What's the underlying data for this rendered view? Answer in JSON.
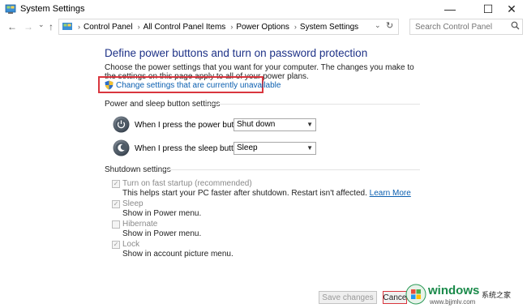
{
  "window": {
    "title": "System Settings",
    "minimize": "—",
    "maximize": "☐",
    "close": "✕"
  },
  "nav": {
    "back": "←",
    "forward": "→",
    "recent": "⌄",
    "up": "↑",
    "crumbs": [
      "Control Panel",
      "All Control Panel Items",
      "Power Options",
      "System Settings"
    ],
    "crumb_separator": "›",
    "dropdown": "⌄",
    "refresh": "↻",
    "search_placeholder": "Search Control Panel"
  },
  "main": {
    "heading": "Define power buttons and turn on password protection",
    "description": "Choose the power settings that you want for your computer. The changes you make to the settings on this page apply to all of your power plans.",
    "change_link": "Change settings that are currently unavailable",
    "power_group": {
      "title": "Power and sleep button settings",
      "rows": [
        {
          "label": "When I press the power button:",
          "value": "Shut down"
        },
        {
          "label": "When I press the sleep button:",
          "value": "Sleep"
        }
      ]
    },
    "shutdown_group": {
      "title": "Shutdown settings",
      "items": [
        {
          "label": "Turn on fast startup (recommended)",
          "checked": true,
          "desc": "This helps start your PC faster after shutdown. Restart isn't affected.",
          "link": "Learn More"
        },
        {
          "label": "Sleep",
          "checked": true,
          "desc": "Show in Power menu."
        },
        {
          "label": "Hibernate",
          "checked": false,
          "desc": "Show in Power menu."
        },
        {
          "label": "Lock",
          "checked": true,
          "desc": "Show in account picture menu."
        }
      ]
    }
  },
  "buttons": {
    "save": "Save changes",
    "cancel": "Cance"
  },
  "watermark": {
    "main": "windows",
    "sub": "系统之家",
    "url": "www.bjjmlv.com"
  },
  "colors": {
    "heading": "#1e3287",
    "link": "#0b5fb0",
    "highlight": "#d9363e",
    "watermark": "#1a8a4a"
  }
}
